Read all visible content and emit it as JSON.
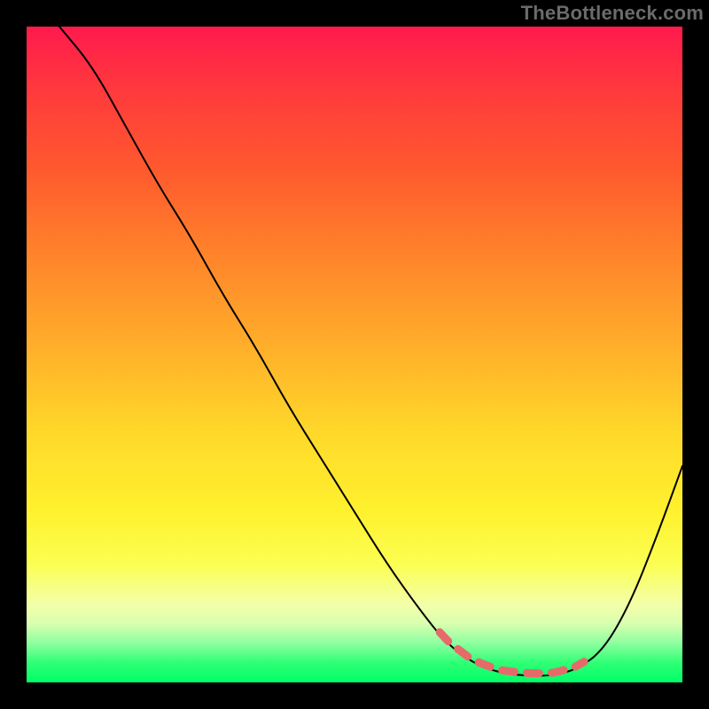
{
  "watermark": "TheBottleneck.com",
  "colors": {
    "frame_border": "#000000",
    "curve": "#000000",
    "dotted": "#e76a6a",
    "gradient_top": "#ff1a4d",
    "gradient_bottom": "#00ff69"
  },
  "chart_data": {
    "type": "line",
    "title": "",
    "xlabel": "",
    "ylabel": "",
    "xlim": [
      0,
      100
    ],
    "ylim": [
      0,
      100
    ],
    "grid": false,
    "legend": false,
    "series": [
      {
        "name": "bottleneck-curve",
        "x": [
          5,
          10,
          15,
          20,
          25,
          30,
          35,
          40,
          45,
          50,
          55,
          60,
          64,
          68,
          72,
          76,
          80,
          84,
          88,
          92,
          96,
          100
        ],
        "y": [
          100,
          94,
          85,
          76,
          68,
          59,
          51,
          42,
          34,
          26,
          18,
          11,
          6,
          3,
          1.5,
          1,
          1,
          2,
          5,
          12,
          22,
          33
        ]
      }
    ],
    "annotations": [
      {
        "name": "sweet-spot-band",
        "type": "dotted-segment",
        "x_start": 63,
        "x_end": 85,
        "y": 1.2,
        "color": "#e76a6a"
      }
    ],
    "background": {
      "type": "vertical-gradient",
      "stops": [
        {
          "pct": 0,
          "hex": "#ff1a4d"
        },
        {
          "pct": 35,
          "hex": "#ff842a"
        },
        {
          "pct": 62,
          "hex": "#ffd92a"
        },
        {
          "pct": 88,
          "hex": "#f4ffa8"
        },
        {
          "pct": 100,
          "hex": "#00ff69"
        }
      ]
    }
  }
}
